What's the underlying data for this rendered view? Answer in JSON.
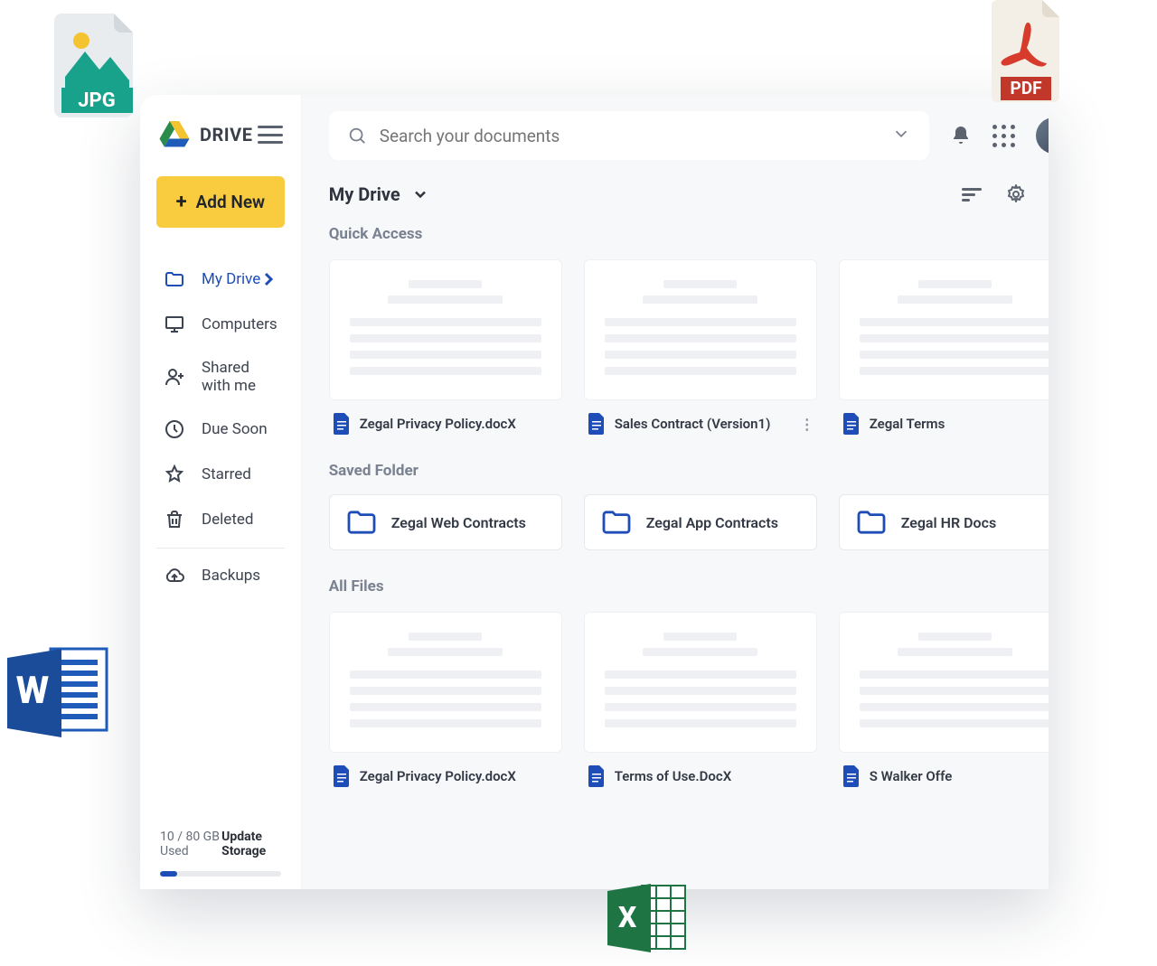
{
  "app": {
    "name": "DRIVE"
  },
  "sidebar": {
    "add_label": "Add New",
    "items": [
      {
        "label": "My Drive"
      },
      {
        "label": "Computers"
      },
      {
        "label": "Shared with me"
      },
      {
        "label": "Due Soon"
      },
      {
        "label": "Starred"
      },
      {
        "label": "Deleted"
      },
      {
        "label": "Backups"
      }
    ],
    "storage_used_text": "10 / 80 GB Used",
    "storage_update_label": "Update Storage",
    "storage_percent": 14
  },
  "search": {
    "placeholder": "Search your documents"
  },
  "breadcrumb": {
    "label": "My Drive"
  },
  "sections": {
    "quick_access": {
      "title": "Quick Access",
      "items": [
        {
          "name": "Zegal Privacy Policy.docX"
        },
        {
          "name": "Sales Contract (Version1)"
        },
        {
          "name": "Zegal Terms"
        }
      ]
    },
    "saved_folder": {
      "title": "Saved Folder",
      "items": [
        {
          "name": "Zegal Web Contracts"
        },
        {
          "name": "Zegal App Contracts"
        },
        {
          "name": "Zegal HR Docs"
        }
      ]
    },
    "all_files": {
      "title": "All Files",
      "items": [
        {
          "name": "Zegal Privacy Policy.docX"
        },
        {
          "name": "Terms of Use.DocX"
        },
        {
          "name": "S Walker Offe"
        }
      ]
    }
  },
  "decorations": {
    "jpg_label": "JPG",
    "pdf_label": "PDF"
  }
}
